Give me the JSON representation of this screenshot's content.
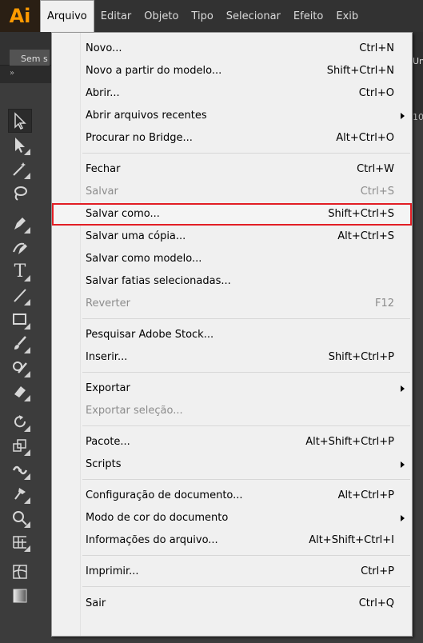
{
  "app": {
    "logo": "Ai"
  },
  "menubar": {
    "items": [
      {
        "label": "Arquivo",
        "active": true
      },
      {
        "label": "Editar"
      },
      {
        "label": "Objeto"
      },
      {
        "label": "Tipo"
      },
      {
        "label": "Selecionar"
      },
      {
        "label": "Efeito"
      },
      {
        "label": "Exib"
      }
    ]
  },
  "control": {
    "doc_label": "Sem s"
  },
  "right_strip": {
    "text_a": "Un",
    "text_b": "10"
  },
  "dropdown": {
    "items": [
      {
        "label": "Novo...",
        "shortcut": "Ctrl+N"
      },
      {
        "label": "Novo a partir do modelo...",
        "shortcut": "Shift+Ctrl+N"
      },
      {
        "label": "Abrir...",
        "shortcut": "Ctrl+O"
      },
      {
        "label": "Abrir arquivos recentes",
        "submenu": true
      },
      {
        "label": "Procurar no Bridge...",
        "shortcut": "Alt+Ctrl+O"
      },
      {
        "label": "Fechar",
        "shortcut": "Ctrl+W"
      },
      {
        "label": "Salvar",
        "shortcut": "Ctrl+S",
        "disabled": true
      },
      {
        "label": "Salvar como...",
        "shortcut": "Shift+Ctrl+S",
        "highlighted": true
      },
      {
        "label": "Salvar uma cópia...",
        "shortcut": "Alt+Ctrl+S"
      },
      {
        "label": "Salvar como modelo..."
      },
      {
        "label": "Salvar fatias selecionadas..."
      },
      {
        "label": "Reverter",
        "shortcut": "F12",
        "disabled": true
      },
      {
        "label": "Pesquisar Adobe Stock..."
      },
      {
        "label": "Inserir...",
        "shortcut": "Shift+Ctrl+P"
      },
      {
        "label": "Exportar",
        "submenu": true
      },
      {
        "label": "Exportar seleção...",
        "disabled": true
      },
      {
        "label": "Pacote...",
        "shortcut": "Alt+Shift+Ctrl+P"
      },
      {
        "label": "Scripts",
        "submenu": true
      },
      {
        "label": "Configuração de documento...",
        "shortcut": "Alt+Ctrl+P"
      },
      {
        "label": "Modo de cor do documento",
        "submenu": true
      },
      {
        "label": "Informações do arquivo...",
        "shortcut": "Alt+Shift+Ctrl+I"
      },
      {
        "label": "Imprimir...",
        "shortcut": "Ctrl+P"
      },
      {
        "label": "Sair",
        "shortcut": "Ctrl+Q"
      }
    ]
  },
  "colors": {
    "highlight_border": "#e21e24",
    "logo": "#ff9a00"
  }
}
